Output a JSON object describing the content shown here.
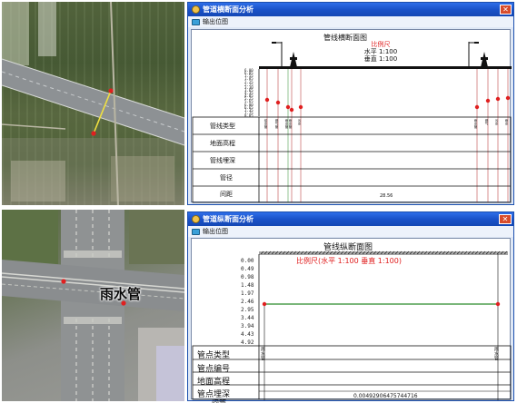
{
  "top_panel": {
    "window_title": "管道横断面分析",
    "toolbar_label": "输出位图",
    "section_title": "管线横断面图",
    "scale_title": "比例尺",
    "scale_horizontal": "水平 1:100",
    "scale_vertical": "垂直 1:100",
    "y_ticks": [
      "6.00",
      "6.85",
      "1.55",
      "1.85",
      "2.25",
      "2.75",
      "3.30",
      "3.65",
      "4.35",
      "4.85",
      "5.25",
      "5.65",
      "6.00",
      "6.65",
      "7.35",
      "7.75",
      "8.85"
    ],
    "row_labels": [
      "管线类型",
      "地面高程",
      "管线埋深",
      "管径",
      "间距"
    ],
    "column_types": [
      "给水管",
      "燃气管",
      "雨水管",
      "雨水管",
      "污水",
      "雨水管",
      "燃气",
      "污水",
      "雨水"
    ],
    "distance_text": "28.56"
  },
  "bottom_panel": {
    "window_title": "管道纵断面分析",
    "toolbar_label": "输出位图",
    "section_title": "管线纵断面图",
    "scale_text": "比例尺(水平 1:100 垂直 1:100)",
    "y_ticks": [
      "0.00",
      "0.49",
      "0.98",
      "1.48",
      "1.97",
      "2.46",
      "2.95",
      "3.44",
      "3.94",
      "4.43",
      "4.92"
    ],
    "row_labels": [
      "管点类型",
      "管点编号",
      "地面高程",
      "管点埋深",
      "间距"
    ],
    "column_types": [
      "雨水管",
      "雨水管"
    ],
    "distance_text": "0.00492906475744716"
  },
  "map_label": "雨水管",
  "colors": {
    "titlebar": "#1a52c9",
    "pipe_point": "#e02020",
    "profile_line": "#2a8a2a",
    "selection_line": "#f0e040"
  }
}
